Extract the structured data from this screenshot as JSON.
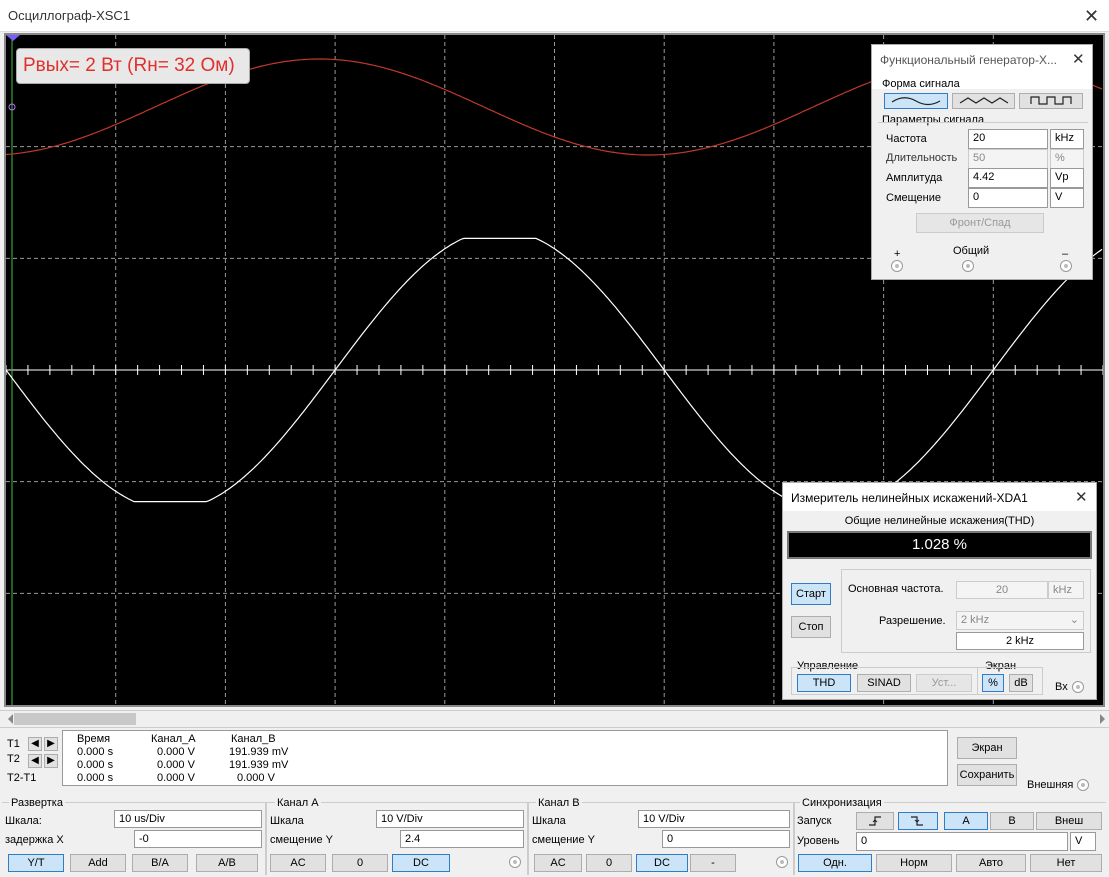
{
  "window": {
    "title": "Осциллограф-XSC1"
  },
  "overlay": {
    "power_label": "Рвых= 2 Вт (Rн= 32 Ом)"
  },
  "colors": {
    "channel_a": "#c0392b",
    "channel_b": "#ffffff",
    "grid": "#9a9a9a",
    "screen_bg": "#000000",
    "accent": "#2f7cc7",
    "badge_text": "#e0302a"
  },
  "generator": {
    "title": "Функциональный генератор-X...",
    "waveform_label": "Форма сигнала",
    "waveforms": [
      "sine-wave-icon",
      "triangle-wave-icon",
      "square-wave-icon"
    ],
    "selected_waveform": "sine",
    "params_label": "Параметры сигнала",
    "params": [
      {
        "label": "Частота",
        "value": "20",
        "unit": "kHz",
        "disabled": false
      },
      {
        "label": "Длительность",
        "value": "50",
        "unit": "%",
        "disabled": true
      },
      {
        "label": "Амплитуда",
        "value": "4.42",
        "unit": "Vp",
        "disabled": false
      },
      {
        "label": "Смещение",
        "value": "0",
        "unit": "V",
        "disabled": false
      }
    ],
    "edge_button": "Фронт/Спад",
    "plus": "+",
    "common": "Общий",
    "minus": "–"
  },
  "thd": {
    "title": "Измеритель нелинейных искажений-XDA1",
    "header": "Общие нелинейные искажения(THD)",
    "value": "1.028 %",
    "start": "Старт",
    "stop": "Стоп",
    "fundamental_label": "Основная частота.",
    "fundamental_value": "20",
    "fundamental_unit": "kHz",
    "resolution_label": "Разрешение.",
    "resolution_value": "2 kHz",
    "resolution_readout": "2 kHz",
    "control_label": "Управление",
    "screen_label": "Экран",
    "thd_btn": "THD",
    "sinad_btn": "SINAD",
    "settings_btn": "Уст...",
    "percent_btn": "%",
    "db_btn": "dB",
    "input_label": "Вх"
  },
  "readout": {
    "headers": [
      "Время",
      "Канал_A",
      "Канал_B"
    ],
    "rows": [
      {
        "label": "T1",
        "time": "0.000 s",
        "a": "0.000 V",
        "b": "191.939 mV"
      },
      {
        "label": "T2",
        "time": "0.000 s",
        "a": "0.000 V",
        "b": "191.939 mV"
      },
      {
        "label": "T2-T1",
        "time": "0.000 s",
        "a": "0.000 V",
        "b": "0.000 V"
      }
    ],
    "screen_btn": "Экран",
    "save_btn": "Сохранить",
    "external_label": "Внешняя"
  },
  "timebase": {
    "title": "Развертка",
    "scale_label": "Шкала:",
    "scale": "10 us/Div",
    "delay_label": "задержка X",
    "delay": "-0",
    "modes": [
      "Y/T",
      "Add",
      "B/A",
      "A/B"
    ]
  },
  "channel_a": {
    "title": "Канал A",
    "scale_label": "Шкала",
    "scale": "10  V/Div",
    "offset_label": "смещение Y",
    "offset": "2.4",
    "coupling": [
      "AC",
      "0",
      "DC"
    ]
  },
  "channel_b": {
    "title": "Канал B",
    "scale_label": "Шкала",
    "scale": "10  V/Div",
    "offset_label": "смещение Y",
    "offset": "0",
    "coupling": [
      "AC",
      "0",
      "DC",
      "-"
    ]
  },
  "trigger": {
    "title": "Синхронизация",
    "edge_label": "Запуск",
    "sources": [
      "A",
      "B",
      "Внеш"
    ],
    "level_label": "Уровень",
    "level": "0",
    "level_unit": "V",
    "modes": [
      "Одн.",
      "Норм",
      "Авто",
      "Нет"
    ]
  }
}
